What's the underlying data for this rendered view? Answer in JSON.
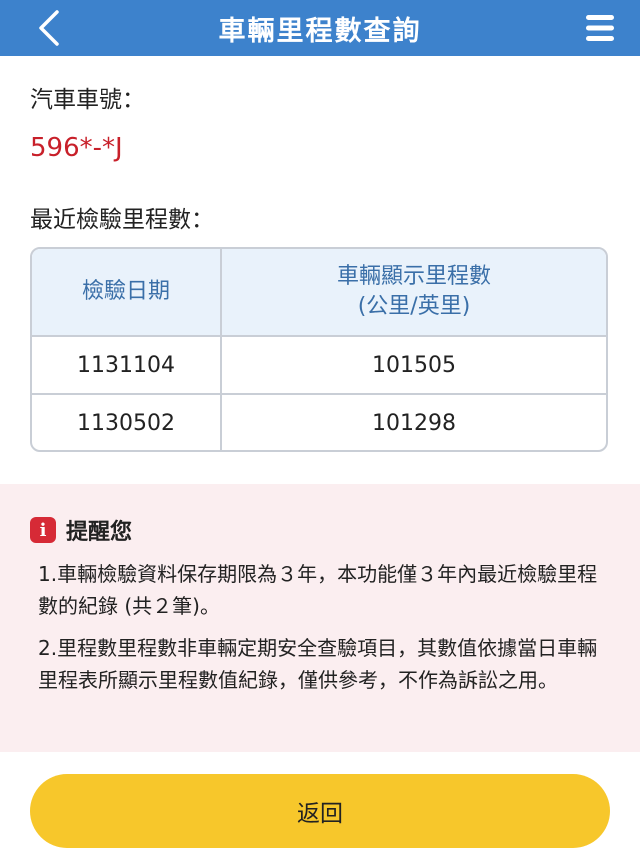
{
  "header": {
    "title": "車輛里程數查詢",
    "back_icon": "chevron-left-icon",
    "menu_icon": "hamburger-menu-icon"
  },
  "vehicle": {
    "plate_label": "汽車車號：",
    "plate_number": "596*-*J"
  },
  "mileage": {
    "section_label": "最近檢驗里程數：",
    "columns": {
      "date": "檢驗日期",
      "odometer_line1": "車輛顯示里程數",
      "odometer_line2": "(公里/英里)"
    },
    "rows": [
      {
        "date": "1131104",
        "odometer": "101505"
      },
      {
        "date": "1130502",
        "odometer": "101298"
      }
    ]
  },
  "notice": {
    "icon": "info-icon",
    "icon_glyph": "i",
    "title": "提醒您",
    "items": [
      "1.車輛檢驗資料保存期限為３年，本功能僅３年內最近檢驗里程數的紀錄 (共２筆)。",
      "2.里程數里程數非車輛定期安全查驗項目，其數值依據當日車輛里程表所顯示里程數值紀錄，僅供參考，不作為訴訟之用。"
    ]
  },
  "footer": {
    "return_label": "返回"
  },
  "colors": {
    "header_bg": "#3d82cc",
    "plate_text": "#c8202a",
    "table_header_bg": "#e9f2fb",
    "table_header_text": "#3a6fa8",
    "notice_bg": "#fbeef0",
    "info_icon": "#d62a36",
    "return_button": "#f7c72b"
  }
}
